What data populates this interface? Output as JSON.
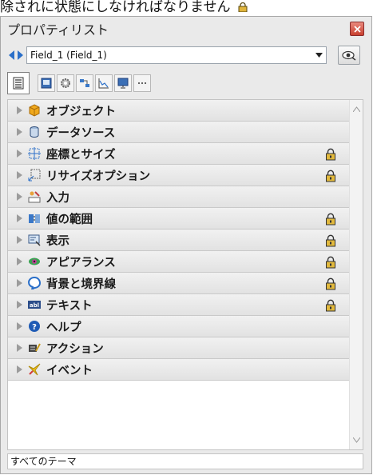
{
  "top_text": "除されに状態にしなければなりません",
  "panel": {
    "title": "プロパティリスト"
  },
  "selector": {
    "value": "Field_1 (Field_1)"
  },
  "tabs": [
    {
      "icon": "list-icon"
    },
    {
      "icon": "form-icon"
    },
    {
      "icon": "gear-icon"
    },
    {
      "icon": "objects-icon"
    },
    {
      "icon": "chart-icon"
    },
    {
      "icon": "monitor-icon"
    },
    {
      "icon": "more-icon"
    }
  ],
  "rows": [
    {
      "label": "オブジェクト",
      "icon": "cube-icon",
      "locked": false
    },
    {
      "label": "データソース",
      "icon": "database-icon",
      "locked": false
    },
    {
      "label": "座標とサイズ",
      "icon": "coordinates-icon",
      "locked": true
    },
    {
      "label": "リサイズオプション",
      "icon": "resize-icon",
      "locked": true
    },
    {
      "label": "入力",
      "icon": "input-icon",
      "locked": false
    },
    {
      "label": "値の範囲",
      "icon": "range-icon",
      "locked": true
    },
    {
      "label": "表示",
      "icon": "display-icon",
      "locked": true
    },
    {
      "label": "アピアランス",
      "icon": "appearance-icon",
      "locked": true
    },
    {
      "label": "背景と境界線",
      "icon": "background-border-icon",
      "locked": true
    },
    {
      "label": "テキスト",
      "icon": "text-icon",
      "locked": true
    },
    {
      "label": "ヘルプ",
      "icon": "help-icon",
      "locked": false
    },
    {
      "label": "アクション",
      "icon": "action-icon",
      "locked": false
    },
    {
      "label": "イベント",
      "icon": "event-icon",
      "locked": false
    }
  ],
  "status": "すべてのテーマ",
  "colors": {
    "panel_bg": "#eaeaea",
    "row_bg": "#e6e6e6",
    "close_red": "#c8402f",
    "lock_gold": "#c79a1c"
  }
}
